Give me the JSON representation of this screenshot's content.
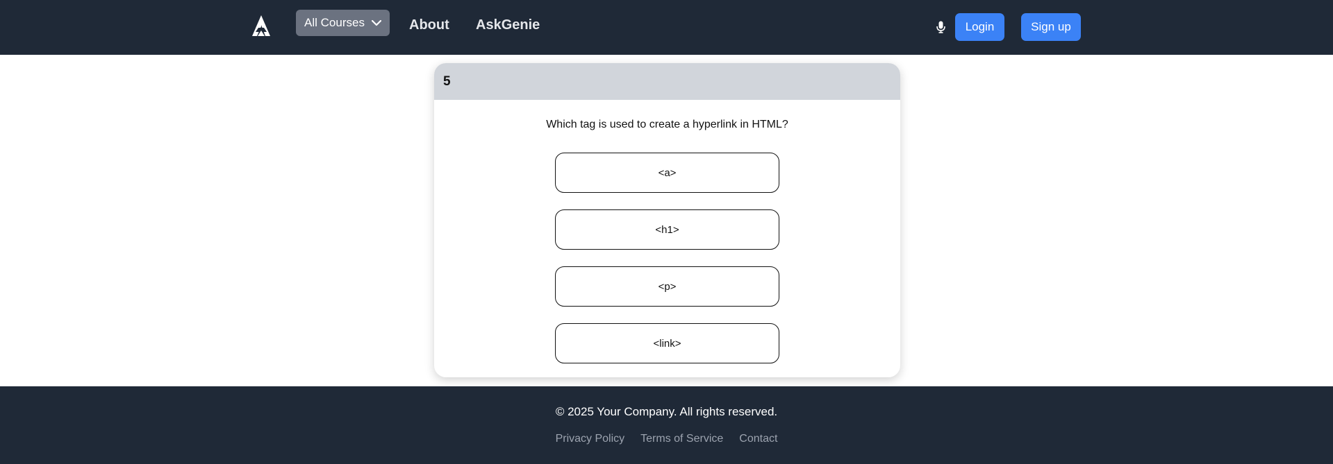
{
  "header": {
    "logo_icon": "triangle-logo-icon",
    "courses_label": "All Courses",
    "nav": {
      "about": "About",
      "askgenie": "AskGenie"
    },
    "mic_icon": "microphone-icon",
    "login_label": "Login",
    "signup_label": "Sign up"
  },
  "quiz": {
    "number": "5",
    "question": "Which tag is used to create a hyperlink in HTML?",
    "options": [
      "<a>",
      "<h1>",
      "<p>",
      "<link>"
    ]
  },
  "footer": {
    "copyright": "© 2025 Your Company. All rights reserved.",
    "links": [
      "Privacy Policy",
      "Terms of Service",
      "Contact"
    ]
  },
  "colors": {
    "navbar_bg": "#1f2937",
    "accent_blue": "#3b82f6",
    "card_header_bg": "#d1d5db",
    "courses_btn_bg": "#6b7280"
  }
}
